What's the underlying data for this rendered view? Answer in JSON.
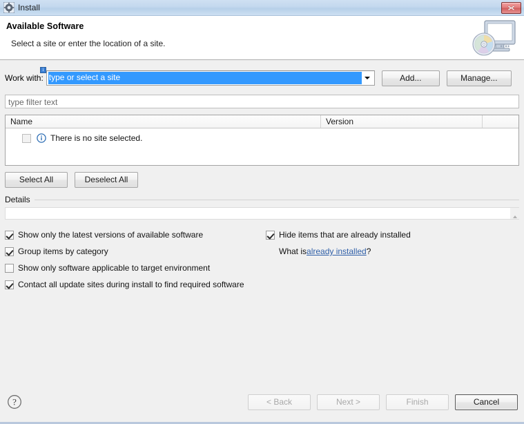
{
  "window": {
    "title": "Install",
    "icon": "install-gear-icon",
    "close_label": "x"
  },
  "header": {
    "title": "Available Software",
    "subtitle": "Select a site or enter the location of a site.",
    "banner_icon": "monitor-with-disc-icon"
  },
  "work_with": {
    "label": "Work with:",
    "value": "type or select a site",
    "placeholder": "type or select a site",
    "decorator_icon": "info-decoration-icon",
    "dropdown_icon": "chevron-down-icon",
    "add_label": "Add...",
    "manage_label": "Manage..."
  },
  "filter": {
    "placeholder": "type filter text",
    "value": ""
  },
  "table": {
    "columns": [
      "Name",
      "Version",
      ""
    ],
    "rows": [
      {
        "checkbox_state": "disabled",
        "icon": "info-icon",
        "name": "There is no site selected.",
        "version": ""
      }
    ]
  },
  "selection_buttons": {
    "select_all": "Select All",
    "deselect_all": "Deselect All"
  },
  "details": {
    "label": "Details",
    "content": "",
    "scroll_icon": "scroll-up-arrow-icon"
  },
  "options": {
    "left": [
      {
        "label": "Show only the latest versions of available software",
        "checked": true
      },
      {
        "label": "Group items by category",
        "checked": true
      },
      {
        "label": "Show only software applicable to target environment",
        "checked": false
      },
      {
        "label": "Contact all update sites during install to find required software",
        "checked": true
      }
    ],
    "right": [
      {
        "label": "Hide items that are already installed",
        "checked": true
      }
    ],
    "what_is_prefix": "What is ",
    "what_is_link": "already installed",
    "what_is_suffix": "?"
  },
  "footer": {
    "help_icon": "help-question-icon",
    "buttons": [
      {
        "label": "< Back",
        "enabled": false
      },
      {
        "label": "Next >",
        "enabled": false
      },
      {
        "label": "Finish",
        "enabled": false
      },
      {
        "label": "Cancel",
        "enabled": true
      }
    ]
  },
  "colors": {
    "titlebar": "#c3d8ee",
    "selection": "#3399ff",
    "link": "#2f5fa8",
    "close": "#d05a5a",
    "body": "#f0f0f0"
  }
}
